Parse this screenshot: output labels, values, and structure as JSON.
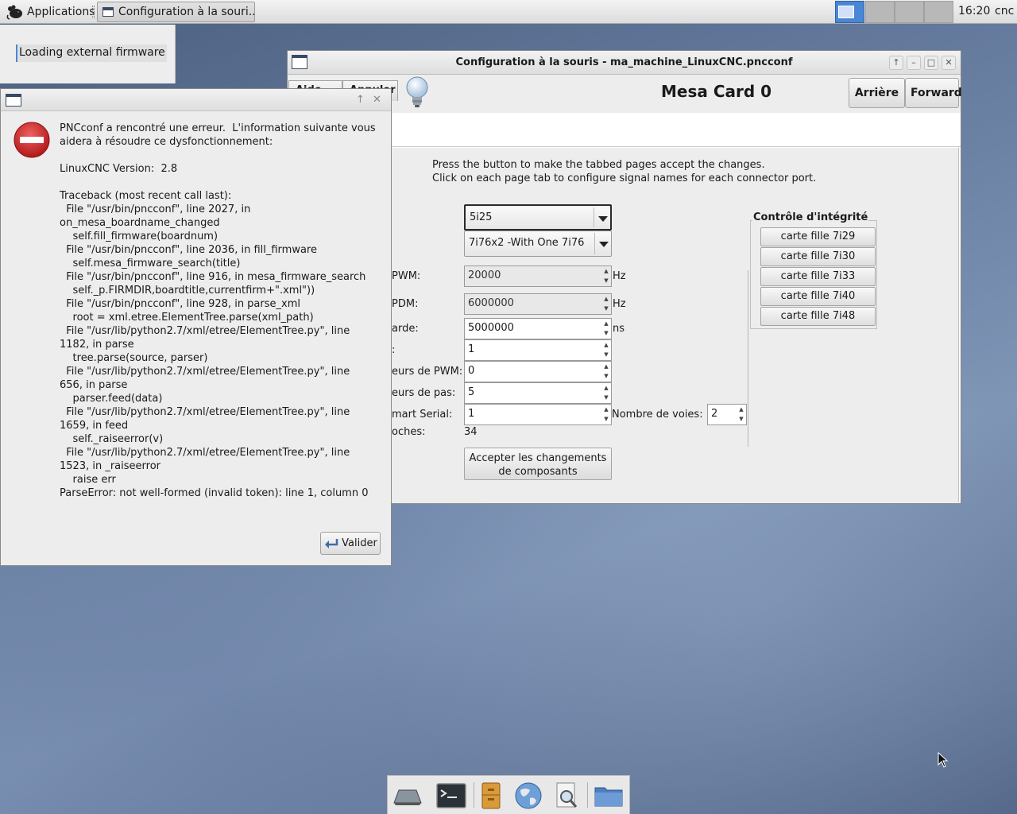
{
  "panel": {
    "apps_label": "Applications",
    "task_label": "Configuration à la souri...",
    "clock": "16:20",
    "user": "cnc"
  },
  "loading": {
    "text": "Loading external firmware"
  },
  "main_window": {
    "title": "Configuration à la souris - ma_machine_LinuxCNC.pncconf",
    "peek_buttons": [
      "Aide",
      "Annuler"
    ],
    "page_header": "Mesa Card 0",
    "back_label": "Arrière",
    "forward_label": "Forward",
    "instructions": [
      "Press the button to make the tabbed pages accept the changes.",
      "Click on each page tab to configure signal names for each connector port."
    ],
    "board_combo": "5i25",
    "firmware_combo": "7i76x2 -With One 7i76",
    "fields": {
      "pwm_label": "PWM:",
      "pwm_value": "20000",
      "pwm_unit": "Hz",
      "pdm_label": "PDM:",
      "pdm_value": "6000000",
      "pdm_unit": "Hz",
      "watchdog_label": "arde:",
      "watchdog_value": "5000000",
      "watchdog_unit": "ns",
      "encoders_label": ":",
      "encoders_value": "1",
      "pwm_gen_label": "eurs de PWM:",
      "pwm_gen_value": "0",
      "stepgen_label": "eurs de pas:",
      "stepgen_value": "5",
      "sserial_label": "mart Serial:",
      "sserial_value": "1",
      "channels_label": "Nombre de voies:",
      "channels_value": "2",
      "pins_label": "oches:",
      "pins_value": "34"
    },
    "accept_label_line1": "Accepter les changements",
    "accept_label_line2": "de composants",
    "sanity_title": "Contrôle d'intégrité",
    "daughter_buttons": [
      "carte fille 7i29",
      "carte fille 7i30",
      "carte fille 7i33",
      "carte fille 7i40",
      "carte fille 7i48"
    ]
  },
  "error_dialog": {
    "message": "PNCconf a rencontré une erreur.  L'information suivante vous aidera à résoudre ce dysfonctionnement:\n\nLinuxCNC Version:  2.8\n\nTraceback (most recent call last):\n  File \"/usr/bin/pncconf\", line 2027, in\non_mesa_boardname_changed\n    self.fill_firmware(boardnum)\n  File \"/usr/bin/pncconf\", line 2036, in fill_firmware\n    self.mesa_firmware_search(title)\n  File \"/usr/bin/pncconf\", line 916, in mesa_firmware_search\n    self._p.FIRMDIR,boardtitle,currentfirm+\".xml\"))\n  File \"/usr/bin/pncconf\", line 928, in parse_xml\n    root = xml.etree.ElementTree.parse(xml_path)\n  File \"/usr/lib/python2.7/xml/etree/ElementTree.py\", line\n1182, in parse\n    tree.parse(source, parser)\n  File \"/usr/lib/python2.7/xml/etree/ElementTree.py\", line\n656, in parse\n    parser.feed(data)\n  File \"/usr/lib/python2.7/xml/etree/ElementTree.py\", line\n1659, in feed\n    self._raiseerror(v)\n  File \"/usr/lib/python2.7/xml/etree/ElementTree.py\", line\n1523, in _raiseerror\n    raise err\nParseError: not well-formed (invalid token): line 1, column 0",
    "ok_label": "Valider"
  },
  "dock": {
    "icons": [
      "show-desktop-icon",
      "terminal-icon",
      "file-manager-icon",
      "web-browser-icon",
      "app-finder-icon",
      "folder-icon"
    ]
  },
  "colors": {
    "accent": "#4a86d4",
    "error_red": "#d42a2a"
  }
}
